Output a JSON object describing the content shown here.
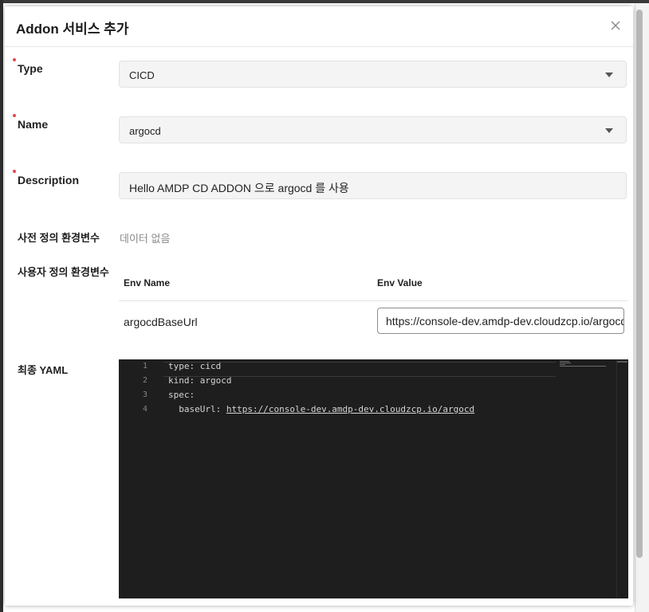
{
  "modal": {
    "title": "Addon 서비스 추가",
    "close_icon": "close-icon"
  },
  "form": {
    "type": {
      "label": "Type",
      "value": "CICD",
      "required": true
    },
    "name": {
      "label": "Name",
      "value": "argocd",
      "required": true
    },
    "description": {
      "label": "Description",
      "value": "Hello AMDP CD ADDON 으로 argocd 를 사용",
      "required": true
    },
    "predefined_env": {
      "label": "사전 정의 환경변수",
      "empty_text": "데이터 없음"
    },
    "custom_env": {
      "label": "사용자 정의 환경변수",
      "columns": [
        "Env Name",
        "Env Value"
      ],
      "rows": [
        {
          "name": "argocdBaseUrl",
          "value": "https://console-dev.amdp-dev.cloudzcp.io/argocd"
        }
      ]
    },
    "yaml": {
      "label": "최종 YAML",
      "lines": [
        {
          "no": "1",
          "text": "type: cicd"
        },
        {
          "no": "2",
          "text": "kind: argocd"
        },
        {
          "no": "3",
          "text": "spec:"
        },
        {
          "no": "4",
          "key": "  baseUrl: ",
          "url": "https://console-dev.amdp-dev.cloudzcp.io/argocd"
        }
      ]
    }
  },
  "colors": {
    "required_marker": "#e5484d",
    "editor_bg": "#1e1e1e",
    "input_bg": "#f4f4f5"
  }
}
